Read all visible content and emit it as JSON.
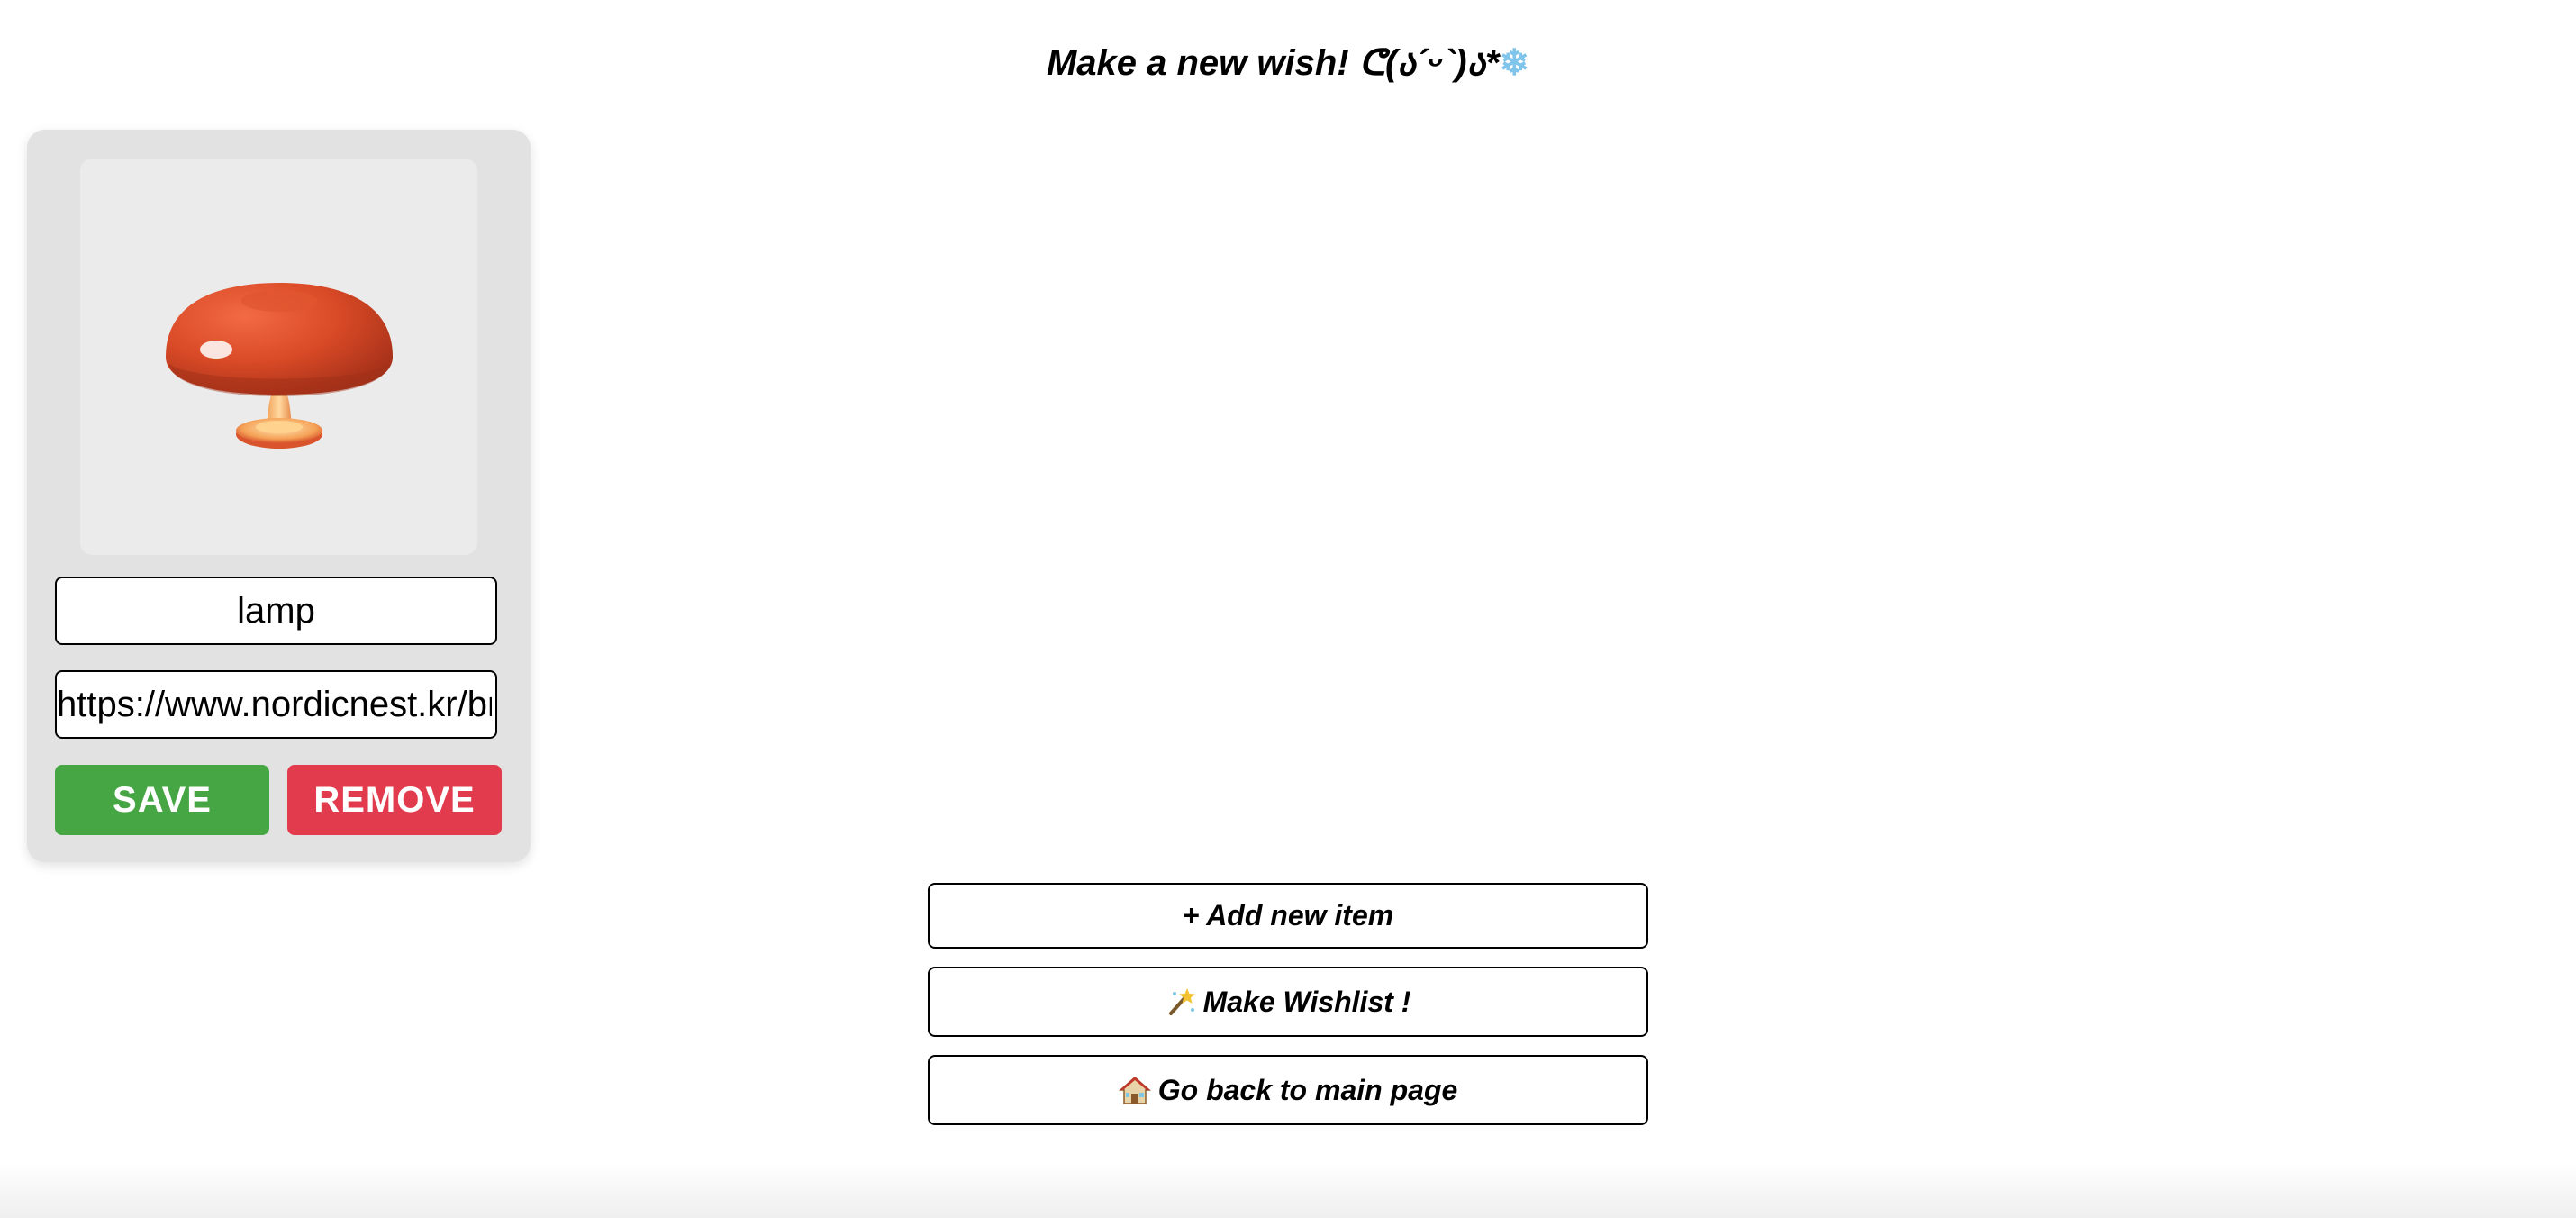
{
  "header": {
    "title": "Make a new wish! ᕦ(ა´ᵕ`)ა*",
    "title_icon": "snowflake-icon"
  },
  "item_card": {
    "image_icon": "mushroom-lamp-image",
    "name_value": "lamp",
    "url_value": "https://www.nordicnest.kr/br",
    "save_label": "SAVE",
    "remove_label": "REMOVE",
    "colors": {
      "card_bg": "#e2e2e2",
      "save": "#46a644",
      "remove": "#e23b4e"
    }
  },
  "actions": {
    "add_label": "+ Add new item",
    "wishlist_label": "Make Wishlist !",
    "wishlist_icon": "magic-wand-icon",
    "home_label": "Go back to main page",
    "home_icon": "house-icon"
  }
}
